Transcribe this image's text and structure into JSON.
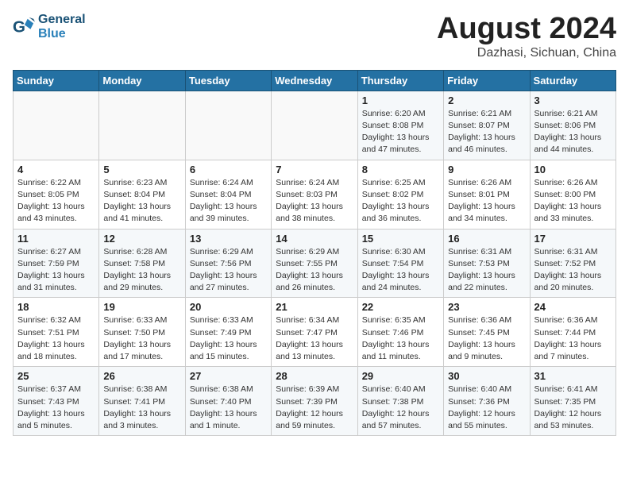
{
  "header": {
    "logo_line1": "General",
    "logo_line2": "Blue",
    "month_title": "August 2024",
    "location": "Dazhasi, Sichuan, China"
  },
  "weekdays": [
    "Sunday",
    "Monday",
    "Tuesday",
    "Wednesday",
    "Thursday",
    "Friday",
    "Saturday"
  ],
  "weeks": [
    [
      {
        "day": "",
        "info": ""
      },
      {
        "day": "",
        "info": ""
      },
      {
        "day": "",
        "info": ""
      },
      {
        "day": "",
        "info": ""
      },
      {
        "day": "1",
        "info": "Sunrise: 6:20 AM\nSunset: 8:08 PM\nDaylight: 13 hours\nand 47 minutes."
      },
      {
        "day": "2",
        "info": "Sunrise: 6:21 AM\nSunset: 8:07 PM\nDaylight: 13 hours\nand 46 minutes."
      },
      {
        "day": "3",
        "info": "Sunrise: 6:21 AM\nSunset: 8:06 PM\nDaylight: 13 hours\nand 44 minutes."
      }
    ],
    [
      {
        "day": "4",
        "info": "Sunrise: 6:22 AM\nSunset: 8:05 PM\nDaylight: 13 hours\nand 43 minutes."
      },
      {
        "day": "5",
        "info": "Sunrise: 6:23 AM\nSunset: 8:04 PM\nDaylight: 13 hours\nand 41 minutes."
      },
      {
        "day": "6",
        "info": "Sunrise: 6:24 AM\nSunset: 8:04 PM\nDaylight: 13 hours\nand 39 minutes."
      },
      {
        "day": "7",
        "info": "Sunrise: 6:24 AM\nSunset: 8:03 PM\nDaylight: 13 hours\nand 38 minutes."
      },
      {
        "day": "8",
        "info": "Sunrise: 6:25 AM\nSunset: 8:02 PM\nDaylight: 13 hours\nand 36 minutes."
      },
      {
        "day": "9",
        "info": "Sunrise: 6:26 AM\nSunset: 8:01 PM\nDaylight: 13 hours\nand 34 minutes."
      },
      {
        "day": "10",
        "info": "Sunrise: 6:26 AM\nSunset: 8:00 PM\nDaylight: 13 hours\nand 33 minutes."
      }
    ],
    [
      {
        "day": "11",
        "info": "Sunrise: 6:27 AM\nSunset: 7:59 PM\nDaylight: 13 hours\nand 31 minutes."
      },
      {
        "day": "12",
        "info": "Sunrise: 6:28 AM\nSunset: 7:58 PM\nDaylight: 13 hours\nand 29 minutes."
      },
      {
        "day": "13",
        "info": "Sunrise: 6:29 AM\nSunset: 7:56 PM\nDaylight: 13 hours\nand 27 minutes."
      },
      {
        "day": "14",
        "info": "Sunrise: 6:29 AM\nSunset: 7:55 PM\nDaylight: 13 hours\nand 26 minutes."
      },
      {
        "day": "15",
        "info": "Sunrise: 6:30 AM\nSunset: 7:54 PM\nDaylight: 13 hours\nand 24 minutes."
      },
      {
        "day": "16",
        "info": "Sunrise: 6:31 AM\nSunset: 7:53 PM\nDaylight: 13 hours\nand 22 minutes."
      },
      {
        "day": "17",
        "info": "Sunrise: 6:31 AM\nSunset: 7:52 PM\nDaylight: 13 hours\nand 20 minutes."
      }
    ],
    [
      {
        "day": "18",
        "info": "Sunrise: 6:32 AM\nSunset: 7:51 PM\nDaylight: 13 hours\nand 18 minutes."
      },
      {
        "day": "19",
        "info": "Sunrise: 6:33 AM\nSunset: 7:50 PM\nDaylight: 13 hours\nand 17 minutes."
      },
      {
        "day": "20",
        "info": "Sunrise: 6:33 AM\nSunset: 7:49 PM\nDaylight: 13 hours\nand 15 minutes."
      },
      {
        "day": "21",
        "info": "Sunrise: 6:34 AM\nSunset: 7:47 PM\nDaylight: 13 hours\nand 13 minutes."
      },
      {
        "day": "22",
        "info": "Sunrise: 6:35 AM\nSunset: 7:46 PM\nDaylight: 13 hours\nand 11 minutes."
      },
      {
        "day": "23",
        "info": "Sunrise: 6:36 AM\nSunset: 7:45 PM\nDaylight: 13 hours\nand 9 minutes."
      },
      {
        "day": "24",
        "info": "Sunrise: 6:36 AM\nSunset: 7:44 PM\nDaylight: 13 hours\nand 7 minutes."
      }
    ],
    [
      {
        "day": "25",
        "info": "Sunrise: 6:37 AM\nSunset: 7:43 PM\nDaylight: 13 hours\nand 5 minutes."
      },
      {
        "day": "26",
        "info": "Sunrise: 6:38 AM\nSunset: 7:41 PM\nDaylight: 13 hours\nand 3 minutes."
      },
      {
        "day": "27",
        "info": "Sunrise: 6:38 AM\nSunset: 7:40 PM\nDaylight: 13 hours\nand 1 minute."
      },
      {
        "day": "28",
        "info": "Sunrise: 6:39 AM\nSunset: 7:39 PM\nDaylight: 12 hours\nand 59 minutes."
      },
      {
        "day": "29",
        "info": "Sunrise: 6:40 AM\nSunset: 7:38 PM\nDaylight: 12 hours\nand 57 minutes."
      },
      {
        "day": "30",
        "info": "Sunrise: 6:40 AM\nSunset: 7:36 PM\nDaylight: 12 hours\nand 55 minutes."
      },
      {
        "day": "31",
        "info": "Sunrise: 6:41 AM\nSunset: 7:35 PM\nDaylight: 12 hours\nand 53 minutes."
      }
    ]
  ]
}
